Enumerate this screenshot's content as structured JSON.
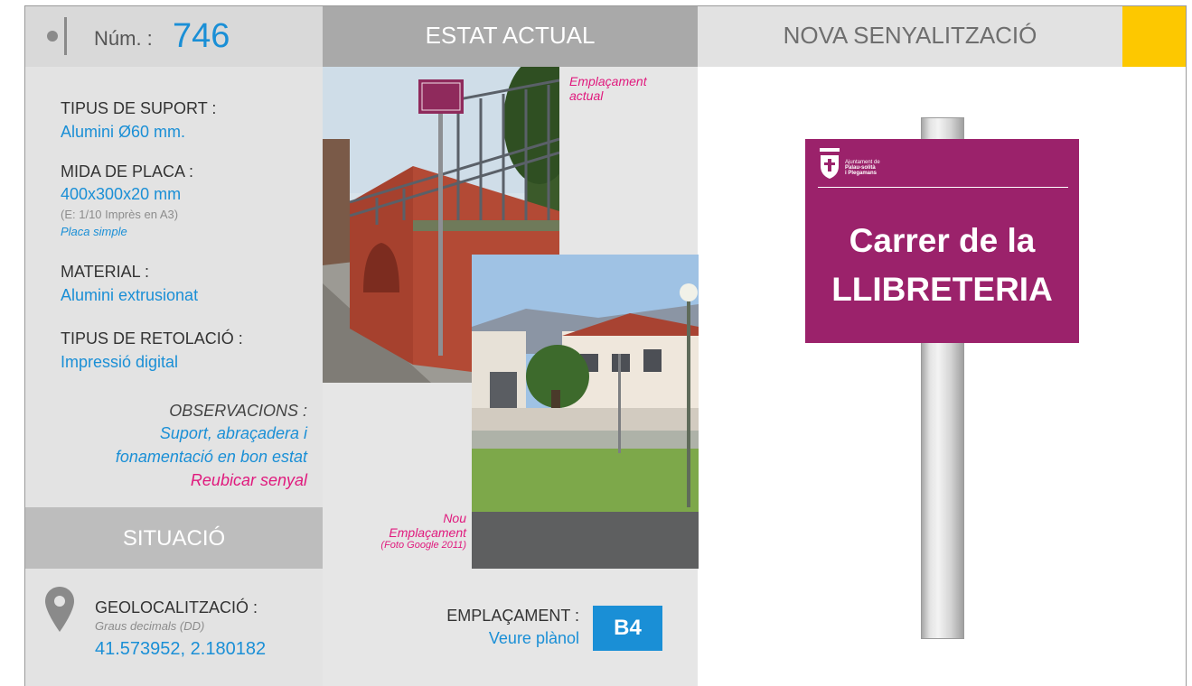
{
  "header": {
    "num_label": "Núm. :",
    "num_value": "746",
    "title_current": "ESTAT ACTUAL",
    "title_new": "NOVA SENYALITZACIÓ"
  },
  "specs": {
    "support_label": "TIPUS DE SUPORT :",
    "support_value": "Alumini Ø60 mm.",
    "plate_label": "MIDA DE PLACA :",
    "plate_value": "400x300x20 mm",
    "plate_scale": "(E: 1/10 Imprès en A3)",
    "plate_type": "Placa simple",
    "material_label": "MATERIAL :",
    "material_value": "Alumini extrusionat",
    "lettering_label": "TIPUS DE RETOLACIÓ :",
    "lettering_value": "Impressió digital"
  },
  "observations": {
    "label": "OBSERVACIONS :",
    "line1": "Suport, abraçadera i",
    "line2": "fonamentació en bon estat",
    "line3": "Reubicar senyal"
  },
  "situation": {
    "title": "SITUACIÓ",
    "geo_label": "GEOLOCALITZACIÓ :",
    "geo_format": "Graus decimals (DD)",
    "geo_value": "41.573952, 2.180182"
  },
  "photos": {
    "current_caption_1": "Emplaçament",
    "current_caption_2": "actual",
    "new_caption_1": "Nou",
    "new_caption_2": "Emplaçament",
    "new_caption_3": "(Foto Google 2011)",
    "small_sign_text": "CARRER DE LA LLIBRETERIA"
  },
  "location": {
    "label": "EMPLAÇAMENT :",
    "link": "Veure plànol",
    "code": "B4"
  },
  "sign": {
    "logo_line1": "Ajuntament de",
    "logo_line2": "Palau-solità",
    "logo_line3": "i Plegamans",
    "street_line1": "Carrer de la",
    "street_line2": "LLIBRETERIA"
  },
  "colors": {
    "accent_blue": "#1a8fd6",
    "accent_pink": "#e0197d",
    "sign_purple": "#9b226b",
    "accent_yellow": "#fdc800"
  },
  "icons": {
    "location": "map-pin-icon",
    "bullet": "dot-icon"
  }
}
